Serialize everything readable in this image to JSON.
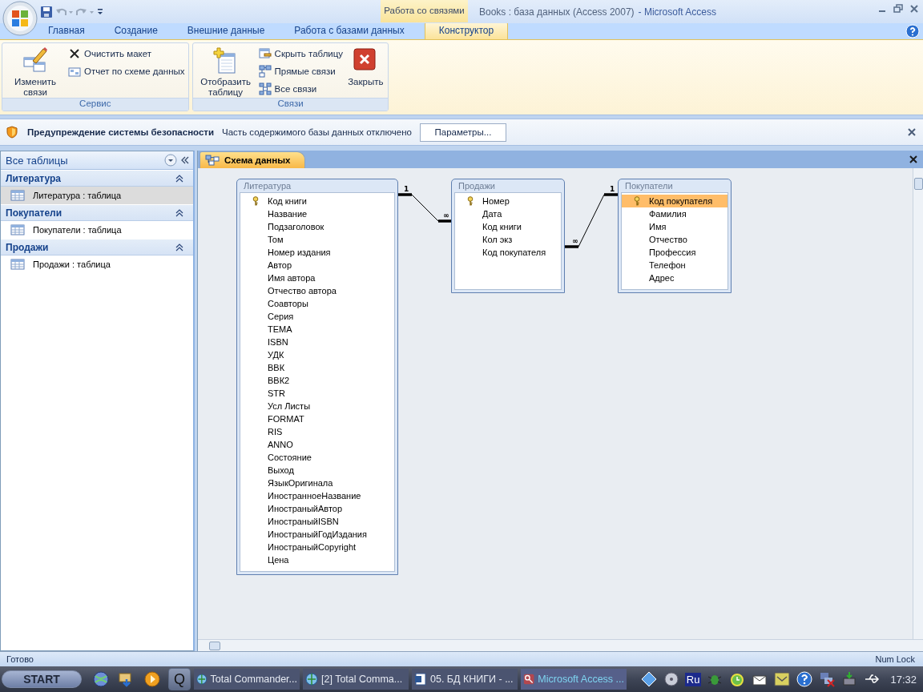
{
  "window": {
    "title": "Books : база данных (Access 2007)",
    "app_name": "- Microsoft Access"
  },
  "contextual_group": "Работа со связями",
  "tabs": [
    {
      "label": "Главная",
      "selected": false
    },
    {
      "label": "Создание",
      "selected": false
    },
    {
      "label": "Внешние данные",
      "selected": false
    },
    {
      "label": "Работа с базами данных",
      "selected": false
    },
    {
      "label": "Конструктор",
      "selected": true
    }
  ],
  "ribbon_groups": [
    {
      "label": "Сервис",
      "commands": [
        {
          "label": "Изменить связи",
          "kind": "large"
        },
        {
          "label": "Очистить макет",
          "kind": "small"
        },
        {
          "label": "Отчет по схеме данных",
          "kind": "small"
        }
      ]
    },
    {
      "label": "Связи",
      "commands": [
        {
          "label": "Отобразить таблицу",
          "kind": "large"
        },
        {
          "label": "Скрыть таблицу",
          "kind": "small"
        },
        {
          "label": "Прямые связи",
          "kind": "small"
        },
        {
          "label": "Все связи",
          "kind": "small"
        },
        {
          "label": "Закрыть",
          "kind": "large"
        }
      ]
    }
  ],
  "security_bar": {
    "title": "Предупреждение системы безопасности",
    "message": "Часть содержимого базы данных отключено",
    "button": "Параметры..."
  },
  "navigation_pane": {
    "header": "Все таблицы",
    "groups": [
      {
        "title": "Литература",
        "items": [
          {
            "label": "Литература : таблица",
            "selected": true
          }
        ]
      },
      {
        "title": "Покупатели",
        "items": [
          {
            "label": "Покупатели : таблица",
            "selected": false
          }
        ]
      },
      {
        "title": "Продажи",
        "items": [
          {
            "label": "Продажи : таблица",
            "selected": false
          }
        ]
      }
    ]
  },
  "document_tab": {
    "label": "Схема данных",
    "selected": true
  },
  "diagram": {
    "tables": [
      {
        "title": "Литература",
        "fields": [
          {
            "name": "Код книги",
            "key": true,
            "selected": false
          },
          {
            "name": "Название",
            "key": false,
            "selected": false
          },
          {
            "name": "Подзаголовок",
            "key": false,
            "selected": false
          },
          {
            "name": "Том",
            "key": false,
            "selected": false
          },
          {
            "name": "Номер издания",
            "key": false,
            "selected": false
          },
          {
            "name": "Автор",
            "key": false,
            "selected": false
          },
          {
            "name": "Имя автора",
            "key": false,
            "selected": false
          },
          {
            "name": "Отчество автора",
            "key": false,
            "selected": false
          },
          {
            "name": "Соавторы",
            "key": false,
            "selected": false
          },
          {
            "name": "Серия",
            "key": false,
            "selected": false
          },
          {
            "name": "ТЕМА",
            "key": false,
            "selected": false
          },
          {
            "name": "ISBN",
            "key": false,
            "selected": false
          },
          {
            "name": "УДК",
            "key": false,
            "selected": false
          },
          {
            "name": "ВВК",
            "key": false,
            "selected": false
          },
          {
            "name": "ВВК2",
            "key": false,
            "selected": false
          },
          {
            "name": "STR",
            "key": false,
            "selected": false
          },
          {
            "name": "Усл Листы",
            "key": false,
            "selected": false
          },
          {
            "name": "FORMAT",
            "key": false,
            "selected": false
          },
          {
            "name": "RIS",
            "key": false,
            "selected": false
          },
          {
            "name": "ANNO",
            "key": false,
            "selected": false
          },
          {
            "name": "Состояние",
            "key": false,
            "selected": false
          },
          {
            "name": "Выход",
            "key": false,
            "selected": false
          },
          {
            "name": "ЯзыкОригинала",
            "key": false,
            "selected": false
          },
          {
            "name": "ИностранноеНазвание",
            "key": false,
            "selected": false
          },
          {
            "name": "ИностраныйАвтор",
            "key": false,
            "selected": false
          },
          {
            "name": "ИностраныйISBN",
            "key": false,
            "selected": false
          },
          {
            "name": "ИностраныйГодИздания",
            "key": false,
            "selected": false
          },
          {
            "name": "ИностраныйCopyright",
            "key": false,
            "selected": false
          },
          {
            "name": "Цена",
            "key": false,
            "selected": false
          }
        ]
      },
      {
        "title": "Продажи",
        "fields": [
          {
            "name": "Номер",
            "key": true,
            "selected": false
          },
          {
            "name": "Дата",
            "key": false,
            "selected": false
          },
          {
            "name": "Код книги",
            "key": false,
            "selected": false
          },
          {
            "name": "Кол экз",
            "key": false,
            "selected": false
          },
          {
            "name": "Код покупателя",
            "key": false,
            "selected": false
          }
        ]
      },
      {
        "title": "Покупатели",
        "fields": [
          {
            "name": "Код покупателя",
            "key": true,
            "selected": true
          },
          {
            "name": "Фамилия",
            "key": false,
            "selected": false
          },
          {
            "name": "Имя",
            "key": false,
            "selected": false
          },
          {
            "name": "Отчество",
            "key": false,
            "selected": false
          },
          {
            "name": "Профессия",
            "key": false,
            "selected": false
          },
          {
            "name": "Телефон",
            "key": false,
            "selected": false
          },
          {
            "name": "Адрес",
            "key": false,
            "selected": false
          }
        ]
      }
    ],
    "relationships": [
      {
        "one_label": "1",
        "many_label": "∞"
      },
      {
        "one_label": "1",
        "many_label": "∞"
      }
    ]
  },
  "status_bar": {
    "status": "Готово",
    "indicator": "Num Lock"
  },
  "taskbar": {
    "start": "START",
    "quick_launch_text": "Q",
    "tasks": [
      {
        "label": "Total Commander...",
        "active": false
      },
      {
        "label": "[2] Total Comma...",
        "active": false
      },
      {
        "label": "05. БД КНИГИ - ...",
        "active": false
      },
      {
        "label": "Microsoft Access ...",
        "active": true
      }
    ],
    "language": "Ru",
    "clock": "17:32"
  }
}
